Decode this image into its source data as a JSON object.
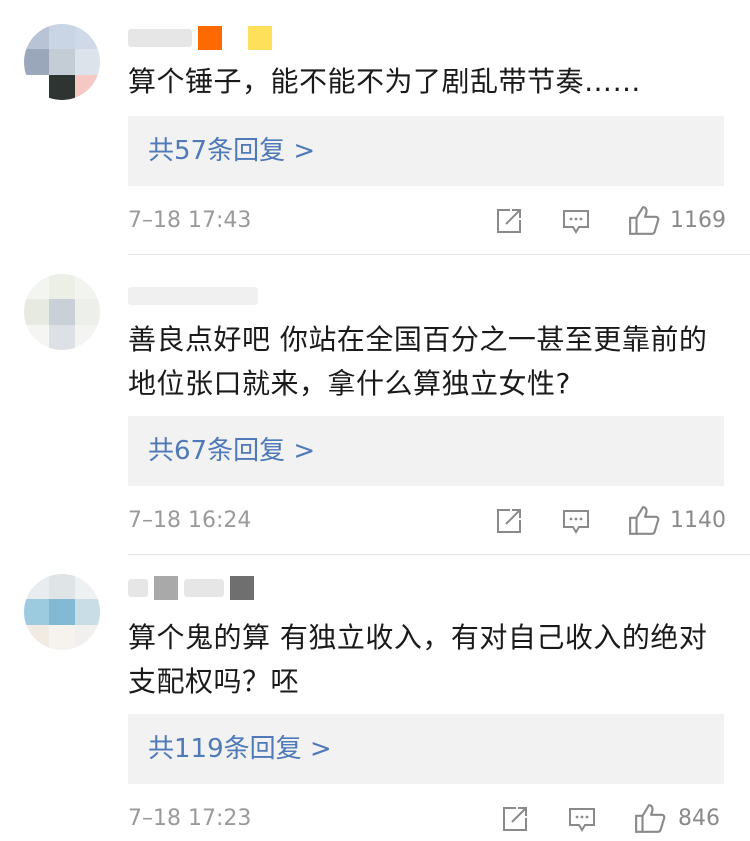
{
  "comments": [
    {
      "text": "算个锤子，能不能不为了剧乱带节奏……",
      "replies_label": "共57条回复 >",
      "time": "7–18 17:43",
      "likes": "1169"
    },
    {
      "text": "善良点好吧 你站在全国百分之一甚至更靠前的地位张口就来，拿什么算独立女性?",
      "replies_label": "共67条回复 >",
      "time": "7–18 16:24",
      "likes": "1140"
    },
    {
      "text": "算个鬼的算 有独立收入，有对自己收入的绝对支配权吗？呸",
      "replies_label": "共119条回复 >",
      "time": "7–18 17:23",
      "likes": "846"
    }
  ],
  "icons": {
    "share": "share-icon",
    "comment": "comment-icon",
    "like": "thumbs-up-icon"
  },
  "colors": {
    "reply_link": "#4f79b8",
    "reply_bg": "#f2f2f2",
    "meta": "#9a9a9a",
    "icon": "#8a8a8a"
  }
}
